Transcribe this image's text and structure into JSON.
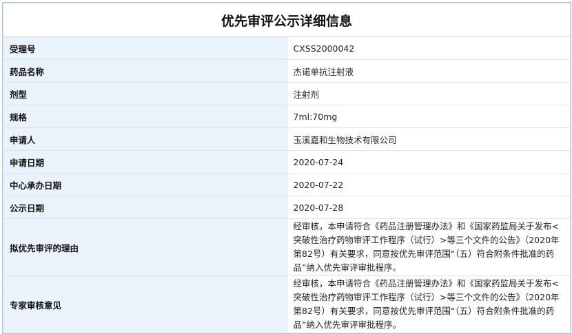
{
  "page": {
    "title": "优先审评公示详细信息"
  },
  "rows": [
    {
      "label": "受理号",
      "value": "CXSS2000042"
    },
    {
      "label": "药品名称",
      "value": "杰诺单抗注射液"
    },
    {
      "label": "剂型",
      "value": "注射剂"
    },
    {
      "label": "规格",
      "value": "7ml:70mg"
    },
    {
      "label": "申请人",
      "value": "玉溪嘉和生物技术有限公司"
    },
    {
      "label": "申请日期",
      "value": "2020-07-24"
    },
    {
      "label": "中心承办日期",
      "value": "2020-07-22"
    },
    {
      "label": "公示日期",
      "value": "2020-07-28"
    },
    {
      "label": "拟优先审评的理由",
      "value": "经审核，本申请符合《药品注册管理办法》和《国家药监局关于发布<突破性治疗药物审评工作程序（试行）>等三个文件的公告》（2020年第82号）有关要求，同意按优先审评范围“（五）符合附条件批准的药品”纳入优先审评审批程序。"
    },
    {
      "label": "专家审核意见",
      "value": "经审核，本申请符合《药品注册管理办法》和《国家药监局关于发布<突破性治疗药物审评工作程序（试行）>等三个文件的公告》（2020年第82号）有关要求，同意按优先审评范围“（五）符合附条件批准的药品”纳入优先审评审批程序。"
    }
  ]
}
